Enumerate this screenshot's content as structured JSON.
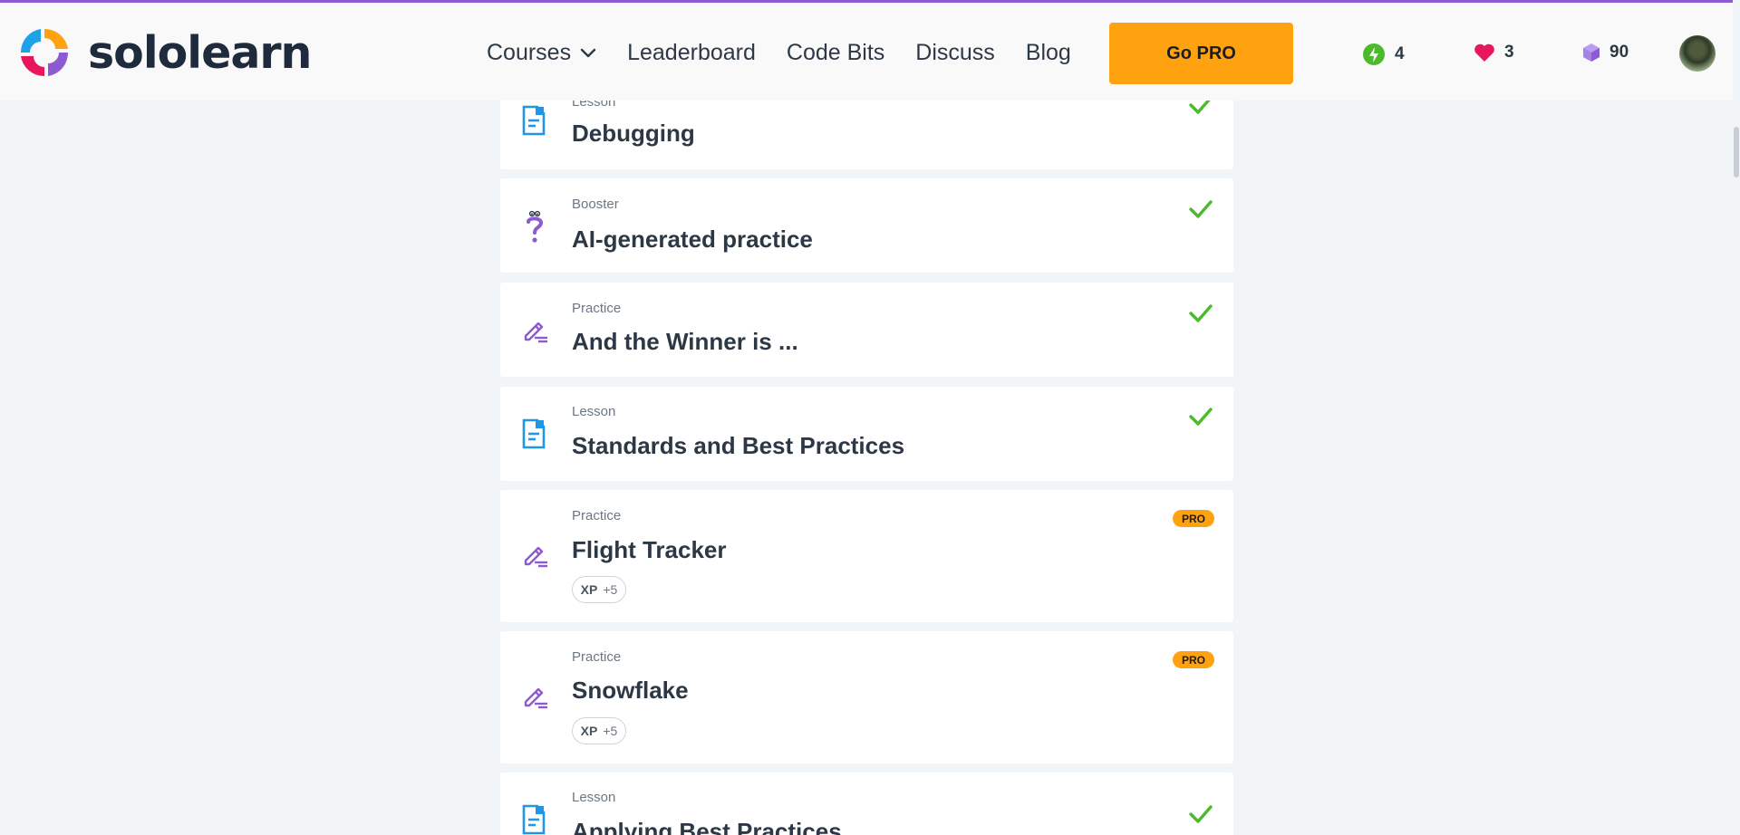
{
  "brand": {
    "name": "sololearn",
    "logo_icon": "sololearn-logo-icon"
  },
  "nav": {
    "courses": "Courses",
    "leaderboard": "Leaderboard",
    "code_bits": "Code Bits",
    "discuss": "Discuss",
    "blog": "Blog",
    "go_pro": "Go PRO"
  },
  "stats": {
    "streak": "4",
    "hearts": "3",
    "gems": "90"
  },
  "colors": {
    "accent": "#8c5ad1",
    "pro": "#ffa20f",
    "check": "#4cba2c",
    "lesson_icon": "#2196e6",
    "practice_icon": "#8c5ad1",
    "streak": "#4cba2c",
    "heart": "#e8175d",
    "gem": "#9f7ae0"
  },
  "items": [
    {
      "type": "Lesson",
      "title": "Debugging",
      "icon": "lesson-icon",
      "completed": true
    },
    {
      "type": "Booster",
      "title": "AI-generated practice",
      "icon": "booster-icon",
      "completed": true
    },
    {
      "type": "Practice",
      "title": "And the Winner is ...",
      "icon": "practice-icon",
      "completed": true
    },
    {
      "type": "Lesson",
      "title": "Standards and Best Practices",
      "icon": "lesson-icon",
      "completed": true
    },
    {
      "type": "Practice",
      "title": "Flight Tracker",
      "icon": "practice-icon",
      "pro": "PRO",
      "xp_label": "XP",
      "xp_value": "+5"
    },
    {
      "type": "Practice",
      "title": "Snowflake",
      "icon": "practice-icon",
      "pro": "PRO",
      "xp_label": "XP",
      "xp_value": "+5"
    },
    {
      "type": "Lesson",
      "title": "Applying Best Practices",
      "icon": "lesson-icon",
      "completed": true
    }
  ]
}
